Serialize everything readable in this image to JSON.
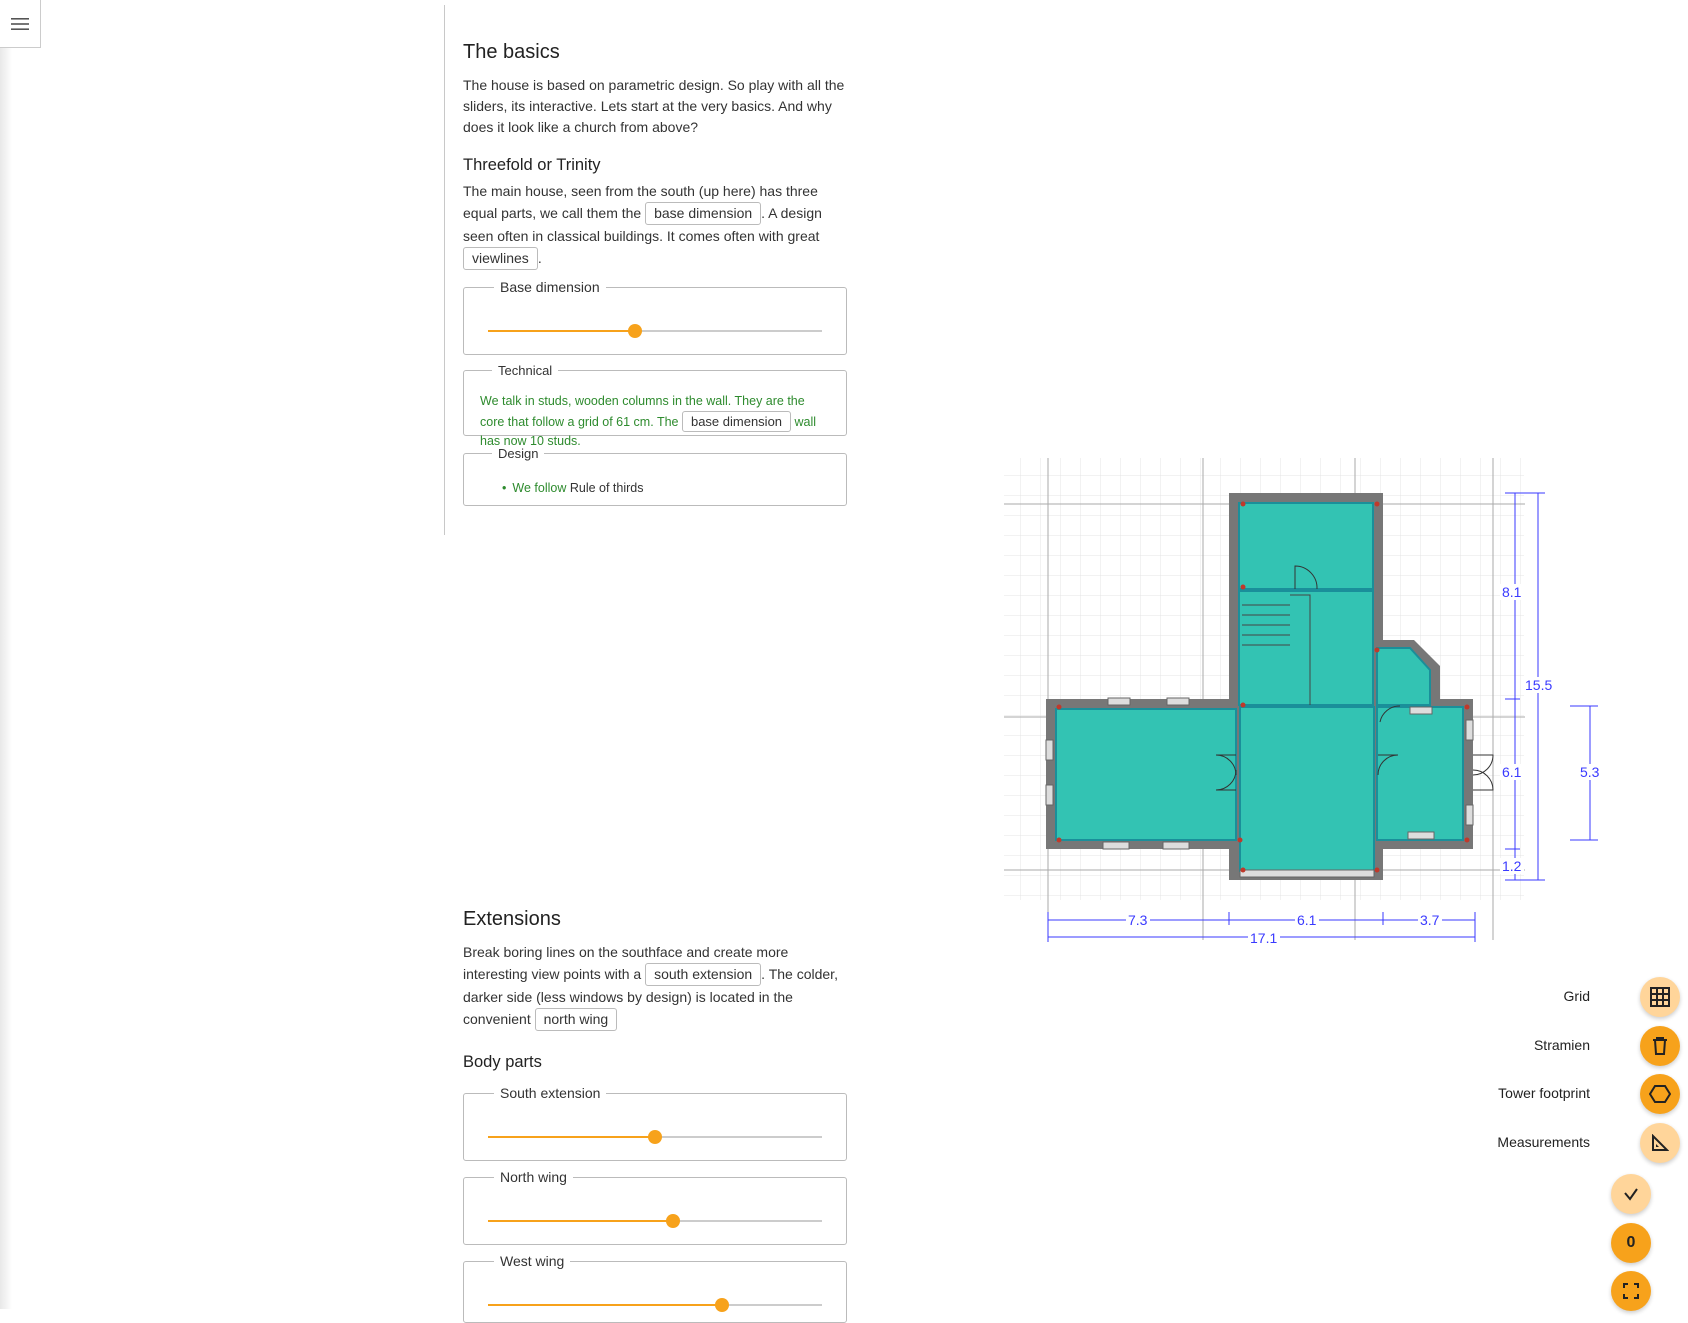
{
  "basics": {
    "title": "The basics",
    "intro": "The house is based on parametric design. So play with all the sliders, its interactive. Lets start at the very basics. And why does it look like a church from above?",
    "subtitle": "Threefold or Trinity",
    "text_a": "The main house, seen from the south (up here) has three equal parts, we call them the",
    "chip_base": "base dimension",
    "text_b": ". A design seen often in classical buildings. It comes often with great",
    "chip_viewlines": "viewlines",
    "text_c": ".",
    "base_slider": {
      "label": "Base dimension",
      "value": 0.44
    },
    "technical": {
      "legend": "Technical",
      "text_a": "We talk in studs, wooden columns in the wall. They are the core that follow a grid of 61 cm. The",
      "chip": "base dimension",
      "text_b": "wall has now 10 studs."
    },
    "design": {
      "legend": "Design",
      "item_prefix": "We follow",
      "item_link": "Rule of thirds"
    }
  },
  "extensions": {
    "title": "Extensions",
    "text_a": "Break boring lines on the southface and create more interesting view points with a",
    "chip_south": "south extension",
    "text_b": ". The colder, darker side (less windows by design) is located in the convenient",
    "chip_north": "north wing",
    "subtitle": "Body parts",
    "sliders": [
      {
        "label": "South extension",
        "value": 0.5
      },
      {
        "label": "North wing",
        "value": 0.555
      },
      {
        "label": "West wing",
        "value": 0.7
      }
    ]
  },
  "plan": {
    "dims": {
      "top": "8.1",
      "total": "15.5",
      "mid": "6.1",
      "bottom": "1.2",
      "side": "5.3",
      "w1": "7.3",
      "w2": "6.1",
      "w3": "3.7",
      "wtotal": "17.1"
    },
    "colors": {
      "room": "#33c3b3",
      "wall": "#777777",
      "dim": "#3a3aff"
    }
  },
  "fabs": {
    "grid": "Grid",
    "stramien": "Stramien",
    "tower": "Tower footprint",
    "measurements": "Measurements",
    "counter": "0"
  }
}
